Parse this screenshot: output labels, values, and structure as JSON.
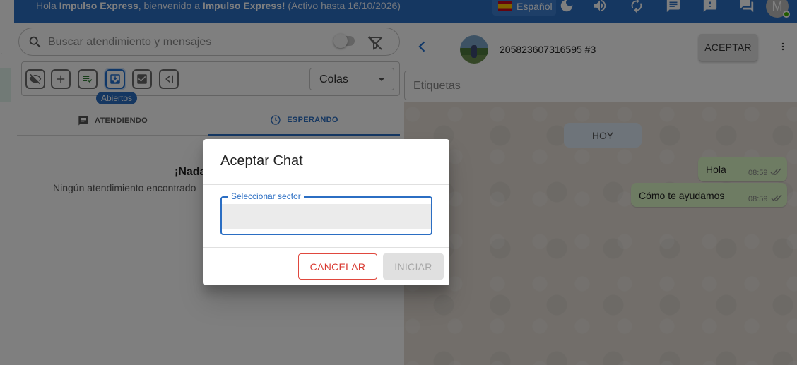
{
  "topbar": {
    "greeting_prefix": "Hola ",
    "user_name": "Impulso Express",
    "greeting_mid": ", bienvenido a ",
    "company_name": "Impulso Express!",
    "active_until": " (Activo hasta 16/10/2026)",
    "language": "Español",
    "avatar_initial": "M",
    "icons": [
      "moon-icon",
      "volume-icon",
      "refresh-icon",
      "chat-icon",
      "alert-icon",
      "forum-icon"
    ]
  },
  "leftpanel": {
    "search_placeholder": "Buscar atendimiento y mensajes",
    "active_filter_tooltip": "Abiertos",
    "queue_select": "Colas",
    "tabs": {
      "attending": "ATENDIENDO",
      "waiting": "ESPERANDO"
    },
    "empty_title": "¡Nada",
    "empty_subtitle": "Ningún atendimiento encontrado"
  },
  "chat": {
    "contact_name": "205823607316595 #3",
    "accept_label": "ACEPTAR",
    "tags_placeholder": "Etiquetas",
    "date_chip": "HOY",
    "messages": [
      {
        "text": "Hola",
        "time": "08:59"
      },
      {
        "text": "Cómo te ayudamos",
        "time": "08:59"
      }
    ]
  },
  "dialog": {
    "title": "Aceptar Chat",
    "sector_label": "Seleccionar sector",
    "sector_value": "",
    "cancel_label": "CANCELAR",
    "start_label": "INICIAR"
  },
  "colors": {
    "primary": "#2b6ec3",
    "danger": "#d93a31",
    "message_bubble": "#dcf8c6"
  }
}
